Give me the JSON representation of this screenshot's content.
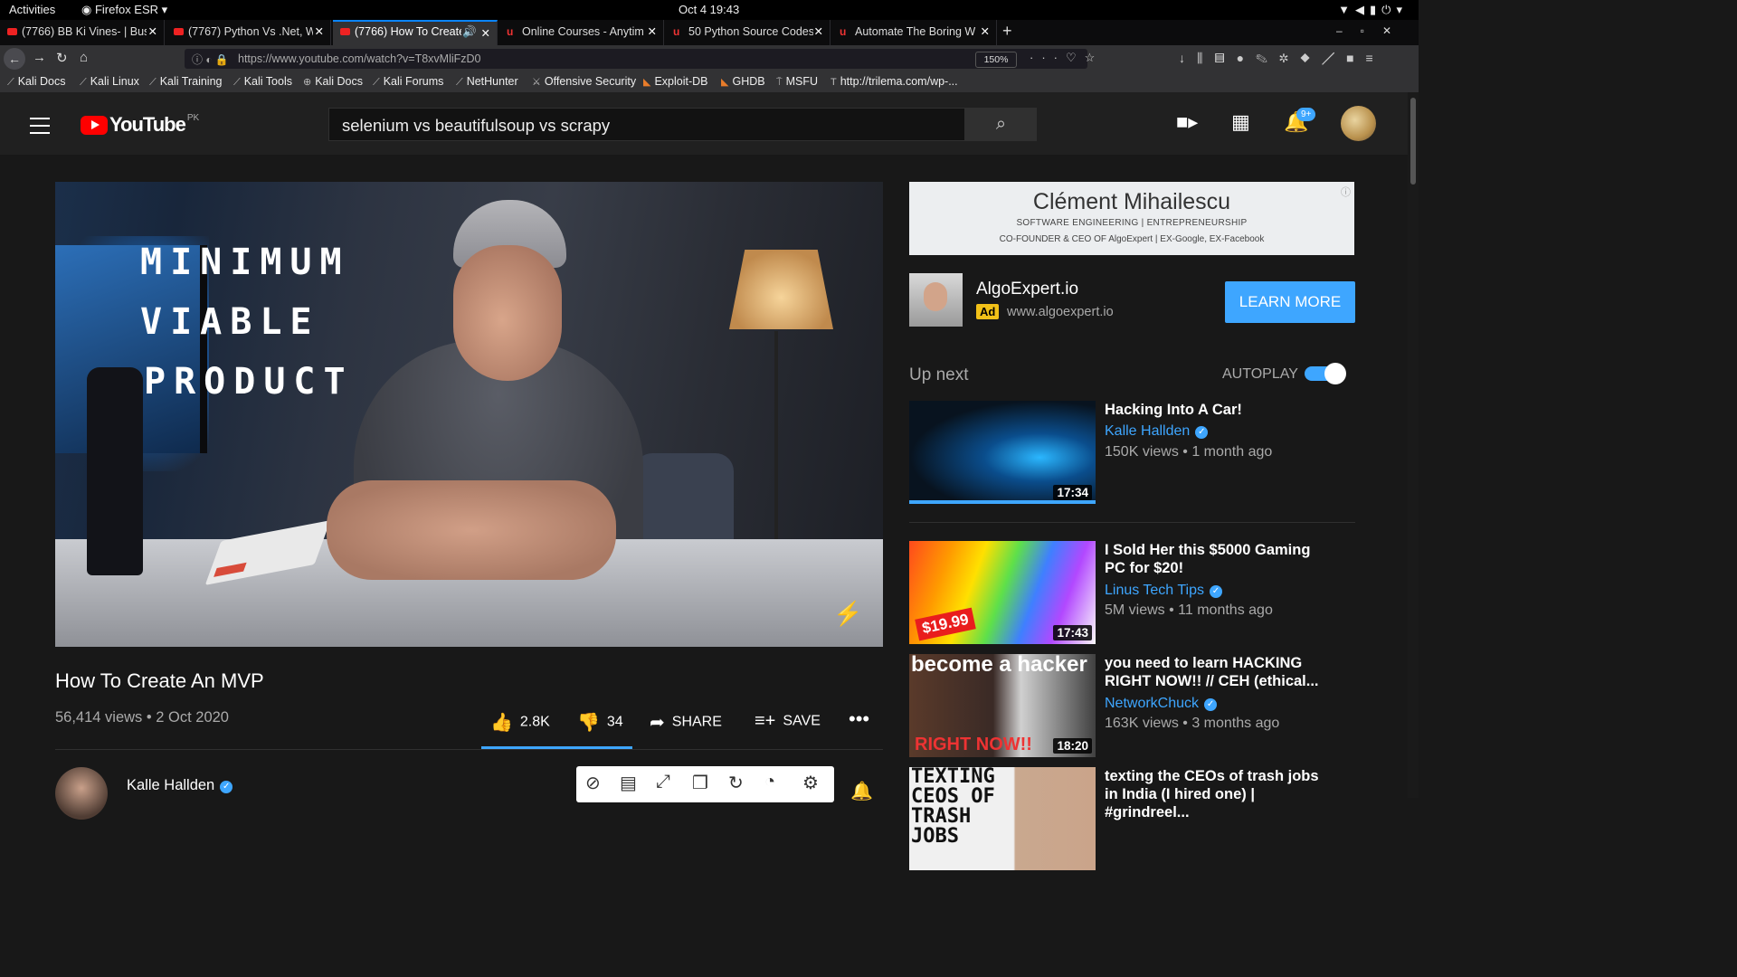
{
  "system_bar": {
    "activities": "Activities",
    "app": "Firefox ESR",
    "clock": "Oct 4  19:43"
  },
  "tabs": [
    {
      "label": "(7766) BB Ki Vines- | Bus",
      "icon": "youtube-icon"
    },
    {
      "label": "(7767) Python Vs .Net, W",
      "icon": "youtube-icon"
    },
    {
      "label": "(7766) How To Create",
      "icon": "youtube-icon",
      "active": true
    },
    {
      "label": "Online Courses - Anytim",
      "icon": "udemy-icon"
    },
    {
      "label": "50 Python Source Codes",
      "icon": "udemy-icon"
    },
    {
      "label": "Automate The Boring W",
      "icon": "udemy-icon"
    }
  ],
  "navbar": {
    "url": "https://www.youtube.com/watch?v=T8xvMliFzD0",
    "zoom": "150%"
  },
  "bookmarks": [
    "Kali Docs",
    "Kali Linux",
    "Kali Training",
    "Kali Tools",
    "Kali Docs",
    "Kali Forums",
    "NetHunter",
    "Offensive Security",
    "Exploit-DB",
    "GHDB",
    "MSFU",
    "http://trilema.com/wp-..."
  ],
  "youtube": {
    "logo_text": "YouTube",
    "region": "PK",
    "search_value": "selenium vs beautifulsoup vs scrapy",
    "notification_count": "9+"
  },
  "video": {
    "overlay_lines": [
      "MINIMUM",
      "VIABLE",
      "PRODUCT"
    ],
    "title": "How To Create An MVP",
    "meta": "56,414 views • 2 Oct 2020",
    "likes": "2.8K",
    "dislikes": "34",
    "share": "SHARE",
    "save": "SAVE",
    "channel": "Kalle Hallden"
  },
  "ad_banner": {
    "name": "Clément Mihailescu",
    "line2": "SOFTWARE ENGINEERING | ENTREPRENEURSHIP",
    "line3": "CO-FOUNDER & CEO OF AlgoExpert | EX-Google, EX-Facebook"
  },
  "ad_card": {
    "title": "AlgoExpert.io",
    "tag": "Ad",
    "url": "www.algoexpert.io",
    "cta": "LEARN MORE"
  },
  "sidebar": {
    "up_next": "Up next",
    "autoplay": "AUTOPLAY",
    "videos": [
      {
        "title": "Hacking Into A Car!",
        "channel": "Kalle Hallden",
        "meta": "150K views • 1 month ago",
        "duration": "17:34"
      },
      {
        "title": "I Sold Her this $5000 Gaming PC for $20!",
        "channel": "Linus Tech Tips",
        "meta": "5M views • 11 months ago",
        "duration": "17:43",
        "thumb_text": "$19.99"
      },
      {
        "title": "you need to learn HACKING RIGHT NOW!! // CEH (ethical...",
        "channel": "NetworkChuck",
        "meta": "163K views • 3 months ago",
        "duration": "18:20",
        "thumb_text": "become a hacker",
        "thumb_text2": "RIGHT NOW!!"
      },
      {
        "title": "texting the CEOs of trash jobs in India (I hired one) | #grindreel...",
        "thumb_text": "TEXTING CEOS OF TRASH JOBS"
      }
    ]
  },
  "colors": {
    "accent": "#3ea6ff",
    "yt_red": "#ff0000",
    "bg": "#181818",
    "header": "#202020"
  }
}
